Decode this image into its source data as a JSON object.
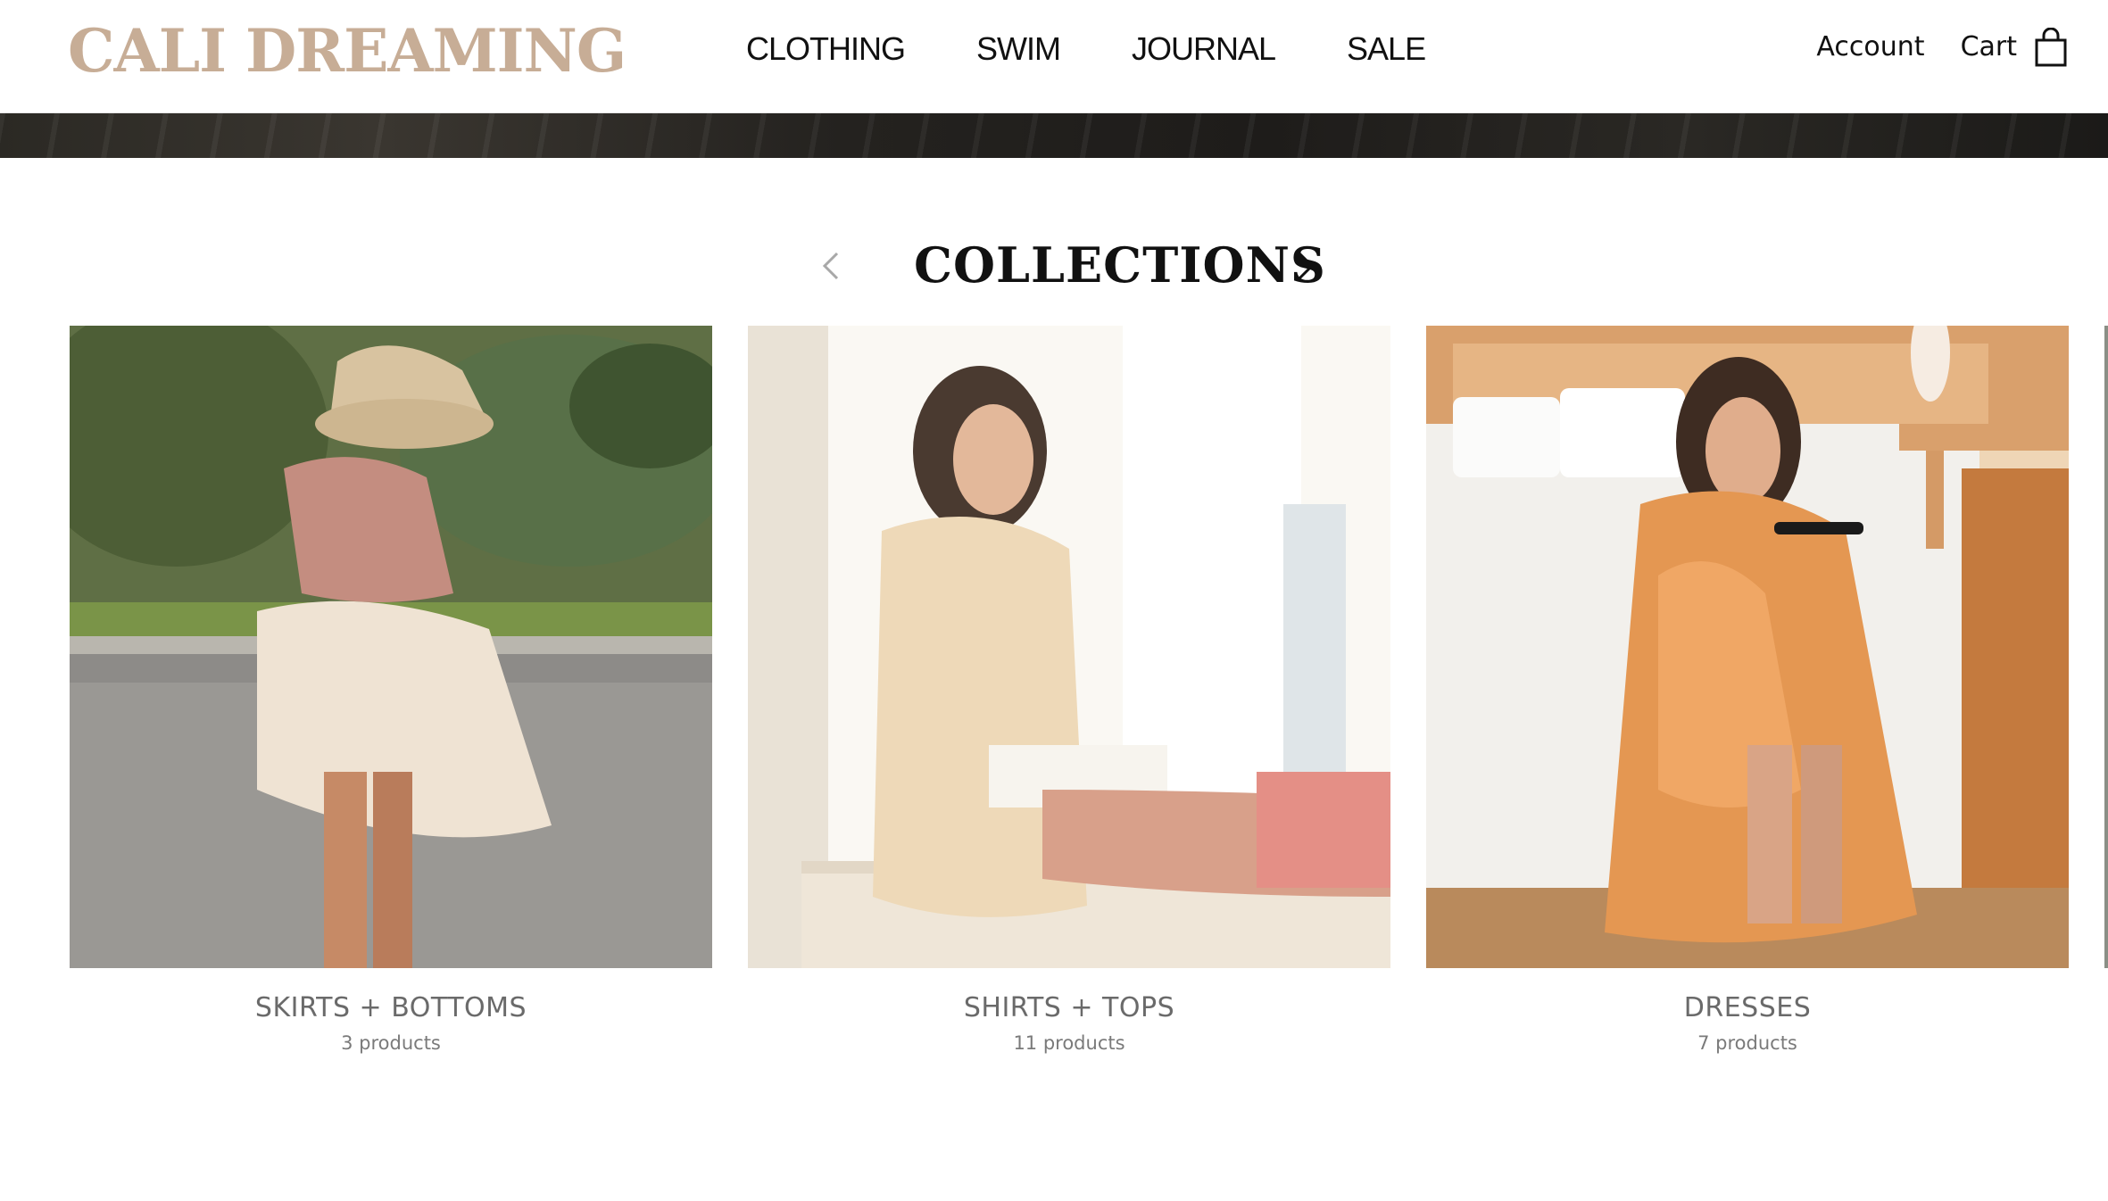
{
  "header": {
    "logo": "CALI DREAMING",
    "nav": [
      {
        "label": "CLOTHING"
      },
      {
        "label": "SWIM"
      },
      {
        "label": "JOURNAL"
      },
      {
        "label": "SALE"
      }
    ],
    "account_label": "Account",
    "cart_label": "Cart",
    "cart_icon": "shopping-bag-icon"
  },
  "collections": {
    "title": "COLLECTIONS",
    "prev_icon": "chevron-left-icon",
    "next_icon": "chevron-right-icon",
    "items": [
      {
        "title": "SKIRTS + BOTTOMS",
        "count": "3 products"
      },
      {
        "title": "SHIRTS + TOPS",
        "count": "11 products"
      },
      {
        "title": "DRESSES",
        "count": "7 products"
      }
    ]
  },
  "colors": {
    "logo": "#c7ad96",
    "text": "#111111",
    "muted": "#6a6a6a"
  }
}
